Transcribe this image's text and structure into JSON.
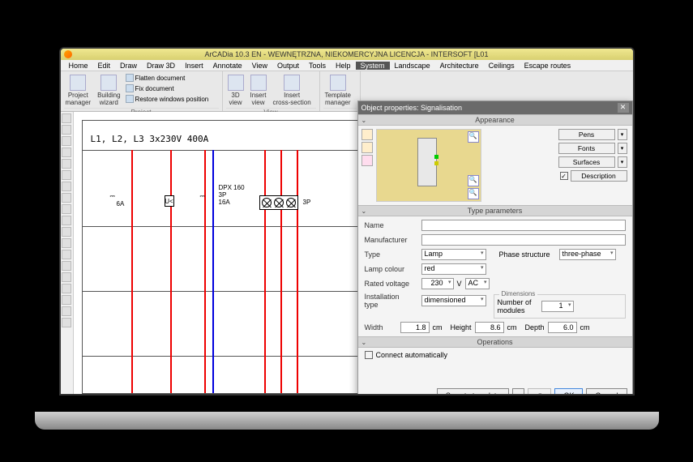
{
  "app": {
    "title": "ArCADia 10.3 EN - WEWNĘTRZNA, NIEKOMERCYJNA LICENCJA - INTERSOFT [L01"
  },
  "menu": {
    "items": [
      "Home",
      "Edit",
      "Draw",
      "Draw 3D",
      "Insert",
      "Annotate",
      "View",
      "Output",
      "Tools",
      "Help",
      "System",
      "Landscape",
      "Architecture",
      "Ceilings",
      "Escape routes"
    ],
    "active": "System"
  },
  "ribbon": {
    "project": {
      "label": "Project",
      "project_manager": "Project\nmanager",
      "building_wizard": "Building\nwizard",
      "flatten": "Flatten document",
      "fix": "Fix document",
      "restore": "Restore windows position"
    },
    "view": {
      "label": "View",
      "v3d": "3D\nview",
      "insert_view": "Insert\nview",
      "cross_section": "Insert\ncross-section"
    },
    "template": {
      "manager": "Template\nmanager"
    }
  },
  "schematic": {
    "label": "L1, L2, L3 3x230V 400A",
    "breaker1": "6A",
    "breaker2": "DPX 160\n3P\n16A",
    "relay": "U<",
    "lamps_label": "3P"
  },
  "dialog": {
    "title": "Object properties: Signalisation",
    "appearance": "Appearance",
    "pens": "Pens",
    "fonts": "Fonts",
    "surfaces": "Surfaces",
    "description": "Description",
    "type_params": "Type parameters",
    "name_lbl": "Name",
    "name_val": "",
    "mfr_lbl": "Manufacturer",
    "mfr_val": "",
    "type_lbl": "Type",
    "type_val": "Lamp",
    "phase_lbl": "Phase structure",
    "phase_val": "three-phase",
    "colour_lbl": "Lamp colour",
    "colour_val": "red",
    "voltage_lbl": "Rated voltage",
    "voltage_val": "230",
    "voltage_unit": "V",
    "ac": "AC",
    "dimensions": "Dimensions",
    "install_lbl": "Installation\ntype",
    "install_val": "dimensioned",
    "modules_lbl": "Number of\nmodules",
    "modules_val": "1",
    "width_lbl": "Width",
    "width_val": "1.8",
    "height_lbl": "Height",
    "height_val": "8.6",
    "depth_lbl": "Depth",
    "depth_val": "6.0",
    "cm": "cm",
    "operations": "Operations",
    "connect_auto": "Connect automatically",
    "save_tpl": "Save to template",
    "ok": "OK",
    "cancel": "Cancel"
  }
}
